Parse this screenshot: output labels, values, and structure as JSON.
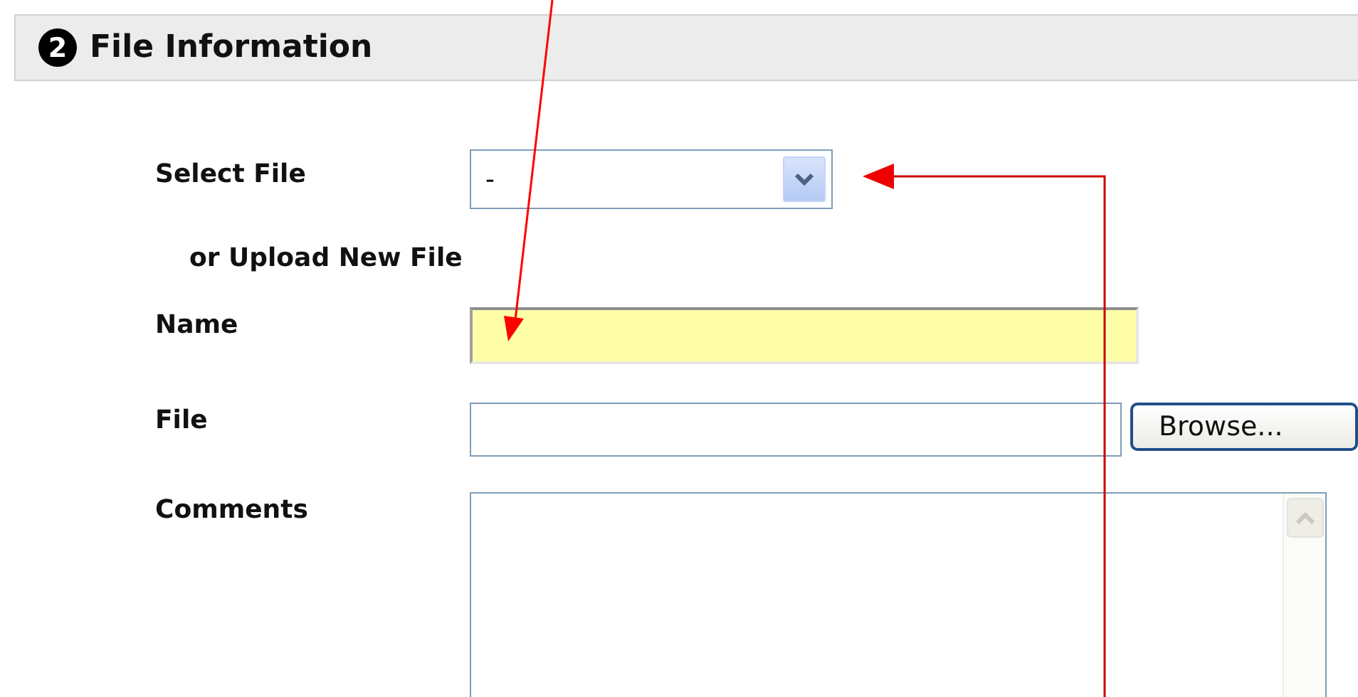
{
  "section": {
    "number": "2",
    "title": "File Information"
  },
  "fields": [
    {
      "kind": "select",
      "label": "Select File",
      "value": "-"
    },
    {
      "kind": "heading",
      "label": "or Upload New File"
    },
    {
      "kind": "text",
      "label": "Name",
      "highlighted": true
    },
    {
      "kind": "file",
      "label": "File",
      "button": "Browse..."
    },
    {
      "kind": "textarea",
      "label": "Comments"
    }
  ]
}
